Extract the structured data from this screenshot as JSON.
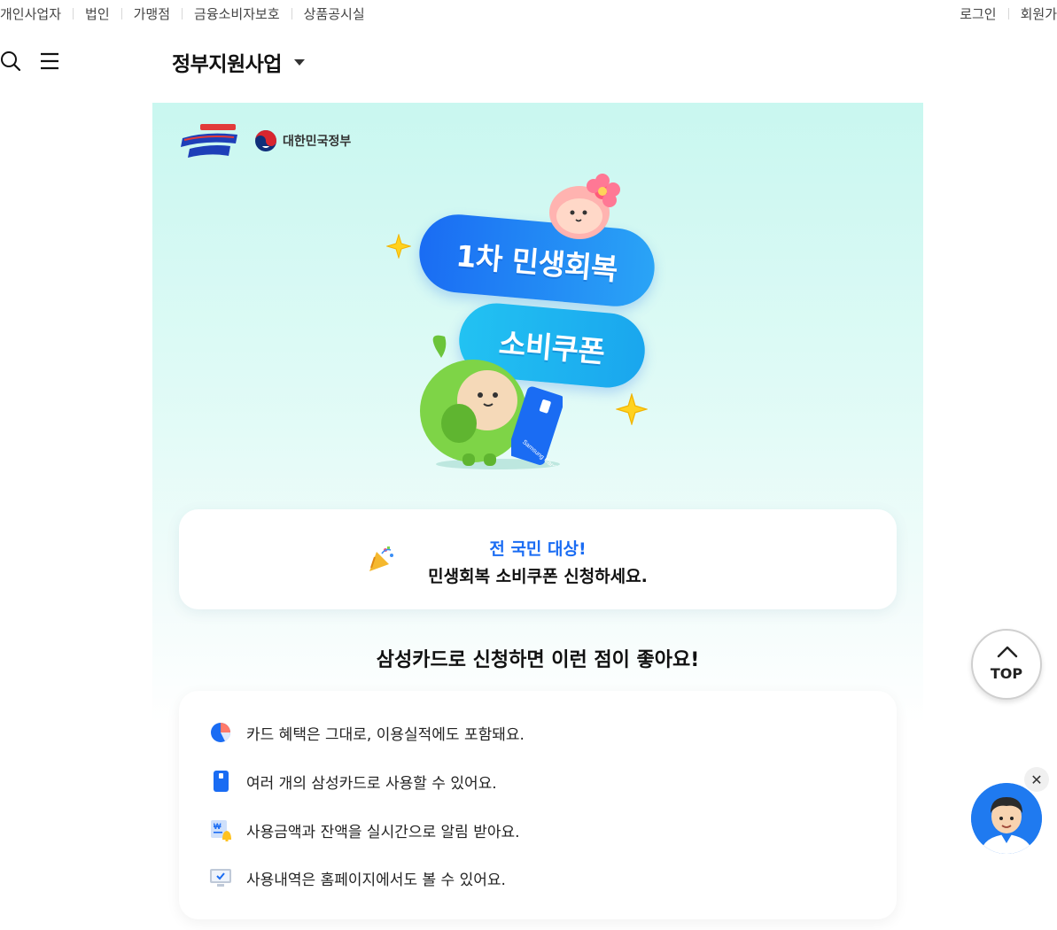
{
  "utility_nav": {
    "left": [
      "개인사업자",
      "법인",
      "가맹점",
      "금융소비자보호",
      "상품공시실"
    ],
    "right": [
      "로그인",
      "회원가"
    ]
  },
  "header": {
    "title": "정부지원사업"
  },
  "hero": {
    "gov_logo_text": "대한민국정부",
    "pill_1": "1차 민생회복",
    "pill_2": "소비쿠폰",
    "card_brand": "Samsung Card"
  },
  "notice": {
    "line1": "전 국민 대상!",
    "line2": "민생회복 소비쿠폰 신청하세요."
  },
  "benefits_section": {
    "title": "삼성카드로 신청하면 이런 점이 좋아요!",
    "items": [
      {
        "icon": "pie-chart-icon",
        "text": "카드 혜택은 그대로, 이용실적에도 포함돼요."
      },
      {
        "icon": "card-icon",
        "text": "여러 개의 삼성카드로 사용할 수 있어요."
      },
      {
        "icon": "won-bell-icon",
        "text": "사용금액과 잔액을 실시간으로 알림 받아요."
      },
      {
        "icon": "monitor-check-icon",
        "text": "사용내역은 홈페이지에서도 볼 수 있어요."
      }
    ]
  },
  "floating": {
    "top_label": "TOP",
    "close_glyph": "✕"
  },
  "colors": {
    "accent_blue": "#1a6cf3",
    "hero_mint": "#c9f7f0"
  }
}
